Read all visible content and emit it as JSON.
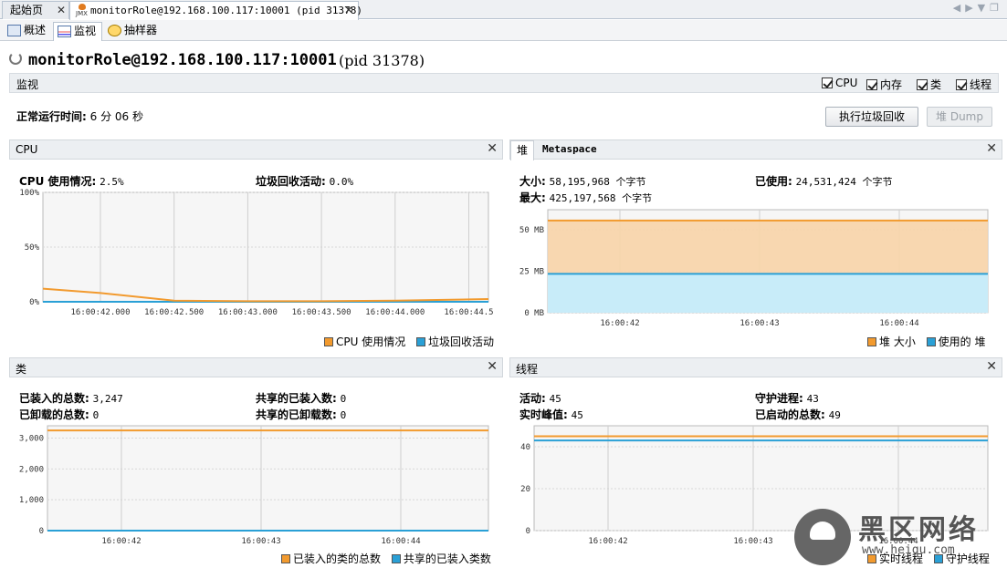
{
  "doc_tabs": [
    {
      "label": "起始页"
    },
    {
      "label": "monitorRole@192.168.100.117:10001 (pid 31378)",
      "icon_text": "JMX"
    }
  ],
  "sub_tabs": [
    {
      "label": "概述"
    },
    {
      "label": "监视"
    },
    {
      "label": "抽样器"
    }
  ],
  "title": {
    "main": "monitorRole@192.168.100.117:10001",
    "pid": "(pid 31378)"
  },
  "monitor": {
    "label": "监视",
    "checkboxes": [
      {
        "label": "CPU",
        "checked": true
      },
      {
        "label": "内存",
        "checked": true
      },
      {
        "label": "类",
        "checked": true
      },
      {
        "label": "线程",
        "checked": true
      }
    ]
  },
  "uptime": {
    "label": "正常运行时间:",
    "value": "6 分 06 秒"
  },
  "buttons": {
    "gc": "执行垃圾回收",
    "heap_dump": "堆 Dump"
  },
  "cpu_panel": {
    "title": "CPU",
    "usage_label": "CPU 使用情况:",
    "usage_value": "2.5%",
    "gc_label": "垃圾回收活动:",
    "gc_value": "0.0%"
  },
  "heap_panel": {
    "tabs": [
      "堆",
      "Metaspace"
    ],
    "size_label": "大小:",
    "size_value": "58,195,968 个字节",
    "used_label": "已使用:",
    "used_value": "24,531,424 个字节",
    "max_label": "最大:",
    "max_value": "425,197,568 个字节"
  },
  "class_panel": {
    "title": "类",
    "loaded_label": "已装入的总数:",
    "loaded_value": "3,247",
    "shared_loaded_label": "共享的已装入数:",
    "shared_loaded_value": "0",
    "unloaded_label": "已卸载的总数:",
    "unloaded_value": "0",
    "shared_unloaded_label": "共享的已卸载数:",
    "shared_unloaded_value": "0"
  },
  "thread_panel": {
    "title": "线程",
    "live_label": "活动:",
    "live_value": "45",
    "daemon_label": "守护进程:",
    "daemon_value": "43",
    "peak_label": "实时峰值:",
    "peak_value": "45",
    "started_label": "已启动的总数:",
    "started_value": "49"
  },
  "colors": {
    "orange": "#f29a2e",
    "blue": "#2aa0d6",
    "heap_fill": "#f8d4a8",
    "used_fill": "#c8ecf9"
  },
  "chart_data": [
    {
      "type": "line",
      "name": "cpu",
      "x": [
        "16:00:41.8",
        "16:00:42.000",
        "16:00:42.500",
        "16:00:43.000",
        "16:00:43.500",
        "16:00:44.000",
        "16:00:44.5"
      ],
      "x_ticks": [
        "16:00:42.000",
        "16:00:42.500",
        "16:00:43.000",
        "16:00:43.500",
        "16:00:44.000",
        "16:00:44.5"
      ],
      "y_ticks": [
        "100%",
        "50%",
        "0%"
      ],
      "ylim": [
        0,
        100
      ],
      "series": [
        {
          "name": "CPU 使用情况",
          "color": "#f29a2e",
          "values": [
            12,
            8,
            1,
            0.5,
            0.5,
            1,
            2.5
          ]
        },
        {
          "name": "垃圾回收活动",
          "color": "#2aa0d6",
          "values": [
            0,
            0,
            0,
            0,
            0,
            0,
            0
          ]
        }
      ]
    },
    {
      "type": "area",
      "name": "heap",
      "x_ticks": [
        "16:00:42",
        "16:00:43",
        "16:00:44"
      ],
      "y_ticks": [
        "50 MB",
        "25 MB",
        "0 MB"
      ],
      "ylim": [
        0,
        62
      ],
      "series": [
        {
          "name": "堆 大小",
          "color": "#f29a2e",
          "values": [
            55.5,
            55.5
          ]
        },
        {
          "name": "使用的 堆",
          "color": "#2aa0d6",
          "values": [
            23.4,
            23.4
          ]
        }
      ]
    },
    {
      "type": "line",
      "name": "classes",
      "x_ticks": [
        "16:00:42",
        "16:00:43",
        "16:00:44"
      ],
      "y_ticks": [
        "3,000",
        "2,000",
        "1,000",
        "0"
      ],
      "ylim": [
        0,
        3400
      ],
      "series": [
        {
          "name": "已装入的类的总数",
          "color": "#f29a2e",
          "values": [
            3247,
            3247
          ]
        },
        {
          "name": "共享的已装入类数",
          "color": "#2aa0d6",
          "values": [
            0,
            0
          ]
        }
      ]
    },
    {
      "type": "line",
      "name": "threads",
      "x_ticks": [
        "16:00:42",
        "16:00:43",
        "16:00:44"
      ],
      "y_ticks": [
        "40",
        "20",
        "0"
      ],
      "ylim": [
        0,
        50
      ],
      "series": [
        {
          "name": "实时线程",
          "color": "#f29a2e",
          "values": [
            45,
            45
          ]
        },
        {
          "name": "守护线程",
          "color": "#2aa0d6",
          "values": [
            43,
            43
          ]
        }
      ]
    }
  ],
  "watermark": {
    "title": "黑区网络",
    "url": "www.heiqu.com"
  }
}
